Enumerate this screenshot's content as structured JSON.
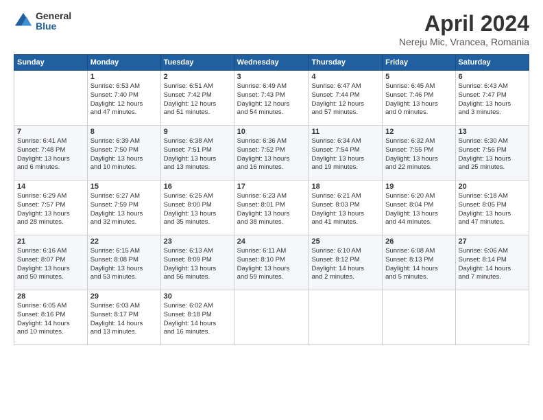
{
  "logo": {
    "general": "General",
    "blue": "Blue"
  },
  "header": {
    "title": "April 2024",
    "subtitle": "Nereju Mic, Vrancea, Romania"
  },
  "days_of_week": [
    "Sunday",
    "Monday",
    "Tuesday",
    "Wednesday",
    "Thursday",
    "Friday",
    "Saturday"
  ],
  "weeks": [
    [
      {
        "day": "",
        "info": ""
      },
      {
        "day": "1",
        "info": "Sunrise: 6:53 AM\nSunset: 7:40 PM\nDaylight: 12 hours\nand 47 minutes."
      },
      {
        "day": "2",
        "info": "Sunrise: 6:51 AM\nSunset: 7:42 PM\nDaylight: 12 hours\nand 51 minutes."
      },
      {
        "day": "3",
        "info": "Sunrise: 6:49 AM\nSunset: 7:43 PM\nDaylight: 12 hours\nand 54 minutes."
      },
      {
        "day": "4",
        "info": "Sunrise: 6:47 AM\nSunset: 7:44 PM\nDaylight: 12 hours\nand 57 minutes."
      },
      {
        "day": "5",
        "info": "Sunrise: 6:45 AM\nSunset: 7:46 PM\nDaylight: 13 hours\nand 0 minutes."
      },
      {
        "day": "6",
        "info": "Sunrise: 6:43 AM\nSunset: 7:47 PM\nDaylight: 13 hours\nand 3 minutes."
      }
    ],
    [
      {
        "day": "7",
        "info": "Sunrise: 6:41 AM\nSunset: 7:48 PM\nDaylight: 13 hours\nand 6 minutes."
      },
      {
        "day": "8",
        "info": "Sunrise: 6:39 AM\nSunset: 7:50 PM\nDaylight: 13 hours\nand 10 minutes."
      },
      {
        "day": "9",
        "info": "Sunrise: 6:38 AM\nSunset: 7:51 PM\nDaylight: 13 hours\nand 13 minutes."
      },
      {
        "day": "10",
        "info": "Sunrise: 6:36 AM\nSunset: 7:52 PM\nDaylight: 13 hours\nand 16 minutes."
      },
      {
        "day": "11",
        "info": "Sunrise: 6:34 AM\nSunset: 7:54 PM\nDaylight: 13 hours\nand 19 minutes."
      },
      {
        "day": "12",
        "info": "Sunrise: 6:32 AM\nSunset: 7:55 PM\nDaylight: 13 hours\nand 22 minutes."
      },
      {
        "day": "13",
        "info": "Sunrise: 6:30 AM\nSunset: 7:56 PM\nDaylight: 13 hours\nand 25 minutes."
      }
    ],
    [
      {
        "day": "14",
        "info": "Sunrise: 6:29 AM\nSunset: 7:57 PM\nDaylight: 13 hours\nand 28 minutes."
      },
      {
        "day": "15",
        "info": "Sunrise: 6:27 AM\nSunset: 7:59 PM\nDaylight: 13 hours\nand 32 minutes."
      },
      {
        "day": "16",
        "info": "Sunrise: 6:25 AM\nSunset: 8:00 PM\nDaylight: 13 hours\nand 35 minutes."
      },
      {
        "day": "17",
        "info": "Sunrise: 6:23 AM\nSunset: 8:01 PM\nDaylight: 13 hours\nand 38 minutes."
      },
      {
        "day": "18",
        "info": "Sunrise: 6:21 AM\nSunset: 8:03 PM\nDaylight: 13 hours\nand 41 minutes."
      },
      {
        "day": "19",
        "info": "Sunrise: 6:20 AM\nSunset: 8:04 PM\nDaylight: 13 hours\nand 44 minutes."
      },
      {
        "day": "20",
        "info": "Sunrise: 6:18 AM\nSunset: 8:05 PM\nDaylight: 13 hours\nand 47 minutes."
      }
    ],
    [
      {
        "day": "21",
        "info": "Sunrise: 6:16 AM\nSunset: 8:07 PM\nDaylight: 13 hours\nand 50 minutes."
      },
      {
        "day": "22",
        "info": "Sunrise: 6:15 AM\nSunset: 8:08 PM\nDaylight: 13 hours\nand 53 minutes."
      },
      {
        "day": "23",
        "info": "Sunrise: 6:13 AM\nSunset: 8:09 PM\nDaylight: 13 hours\nand 56 minutes."
      },
      {
        "day": "24",
        "info": "Sunrise: 6:11 AM\nSunset: 8:10 PM\nDaylight: 13 hours\nand 59 minutes."
      },
      {
        "day": "25",
        "info": "Sunrise: 6:10 AM\nSunset: 8:12 PM\nDaylight: 14 hours\nand 2 minutes."
      },
      {
        "day": "26",
        "info": "Sunrise: 6:08 AM\nSunset: 8:13 PM\nDaylight: 14 hours\nand 5 minutes."
      },
      {
        "day": "27",
        "info": "Sunrise: 6:06 AM\nSunset: 8:14 PM\nDaylight: 14 hours\nand 7 minutes."
      }
    ],
    [
      {
        "day": "28",
        "info": "Sunrise: 6:05 AM\nSunset: 8:16 PM\nDaylight: 14 hours\nand 10 minutes."
      },
      {
        "day": "29",
        "info": "Sunrise: 6:03 AM\nSunset: 8:17 PM\nDaylight: 14 hours\nand 13 minutes."
      },
      {
        "day": "30",
        "info": "Sunrise: 6:02 AM\nSunset: 8:18 PM\nDaylight: 14 hours\nand 16 minutes."
      },
      {
        "day": "",
        "info": ""
      },
      {
        "day": "",
        "info": ""
      },
      {
        "day": "",
        "info": ""
      },
      {
        "day": "",
        "info": ""
      }
    ]
  ]
}
